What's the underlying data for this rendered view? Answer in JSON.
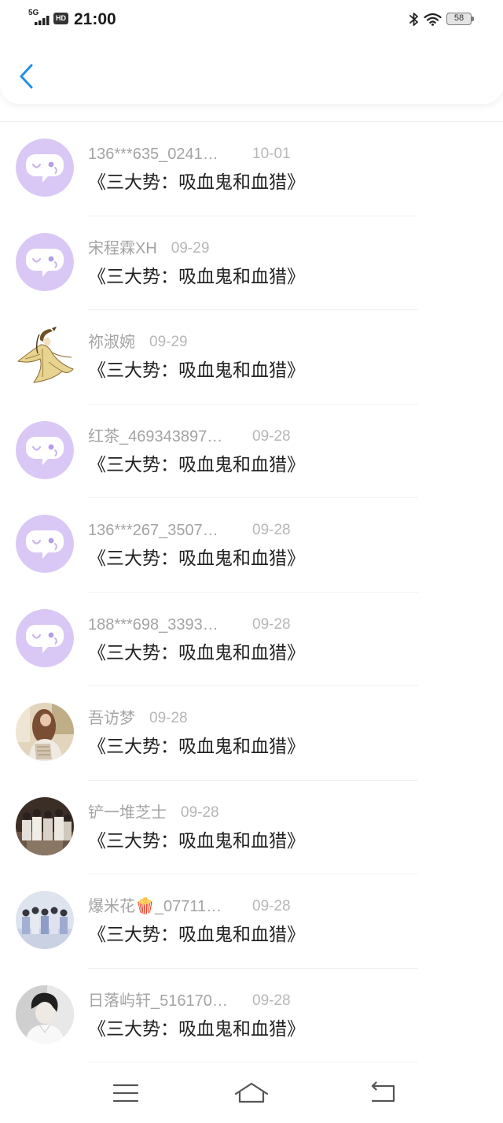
{
  "status_bar": {
    "network_label": "5G",
    "hd_label": "HD",
    "time": "21:00",
    "battery_level": "58",
    "icons": [
      "signal-icon",
      "hd-icon",
      "bluetooth-icon",
      "wifi-icon",
      "battery-icon"
    ]
  },
  "header": {
    "back_icon": "chevron-left-icon"
  },
  "colors": {
    "accent": "#1E8FEF",
    "default_avatar_bg": "#D9C8F6",
    "name_text": "#A4A4A4",
    "title_text": "#222222"
  },
  "list": {
    "items": [
      {
        "name": "136***635_0241…",
        "date": "10-01",
        "title": "《三大势：吸血鬼和血猎》",
        "avatar": "default-chat-avatar"
      },
      {
        "name": "宋程霖XH",
        "date": "09-29",
        "title": "《三大势：吸血鬼和血猎》",
        "avatar": "default-chat-avatar"
      },
      {
        "name": "祢淑婉",
        "date": "09-29",
        "title": "《三大势：吸血鬼和血猎》",
        "avatar": "character-illustration-avatar"
      },
      {
        "name": "红茶_469343897…",
        "date": "09-28",
        "title": "《三大势：吸血鬼和血猎》",
        "avatar": "default-chat-avatar"
      },
      {
        "name": "136***267_3507…",
        "date": "09-28",
        "title": "《三大势：吸血鬼和血猎》",
        "avatar": "default-chat-avatar"
      },
      {
        "name": "188***698_3393…",
        "date": "09-28",
        "title": "《三大势：吸血鬼和血猎》",
        "avatar": "default-chat-avatar"
      },
      {
        "name": "吾访梦",
        "date": "09-28",
        "title": "《三大势：吸血鬼和血猎》",
        "avatar": "photo-avatar"
      },
      {
        "name": "铲一堆芝士",
        "date": "09-28",
        "title": "《三大势：吸血鬼和血猎》",
        "avatar": "photo-avatar"
      },
      {
        "name": "爆米花🍿_07711…",
        "date": "09-28",
        "title": "《三大势：吸血鬼和血猎》",
        "avatar": "photo-avatar"
      },
      {
        "name": "日落屿轩_516170…",
        "date": "09-28",
        "title": "《三大势：吸血鬼和血猎》",
        "avatar": "photo-avatar"
      }
    ]
  },
  "nav_bar": {
    "icons": [
      "menu-icon",
      "home-icon",
      "return-icon"
    ]
  }
}
